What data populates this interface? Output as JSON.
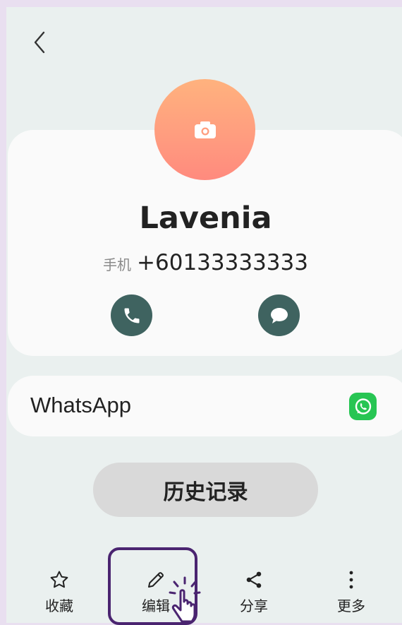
{
  "contact": {
    "name": "Lavenia",
    "phone_label": "手机",
    "phone_number": "+60133333333"
  },
  "apps": {
    "whatsapp_label": "WhatsApp"
  },
  "history_button": "历史记录",
  "bottom_nav": {
    "favorite": "收藏",
    "edit": "编辑",
    "share": "分享",
    "more": "更多"
  },
  "colors": {
    "accent_button": "#3f6360",
    "whatsapp_green": "#27c553",
    "highlight_frame": "#4a2470"
  },
  "icons": [
    "back-arrow-icon",
    "camera-icon",
    "phone-icon",
    "message-icon",
    "whatsapp-icon",
    "star-icon",
    "pencil-icon",
    "share-icon",
    "more-vertical-icon",
    "tap-hand-icon"
  ]
}
